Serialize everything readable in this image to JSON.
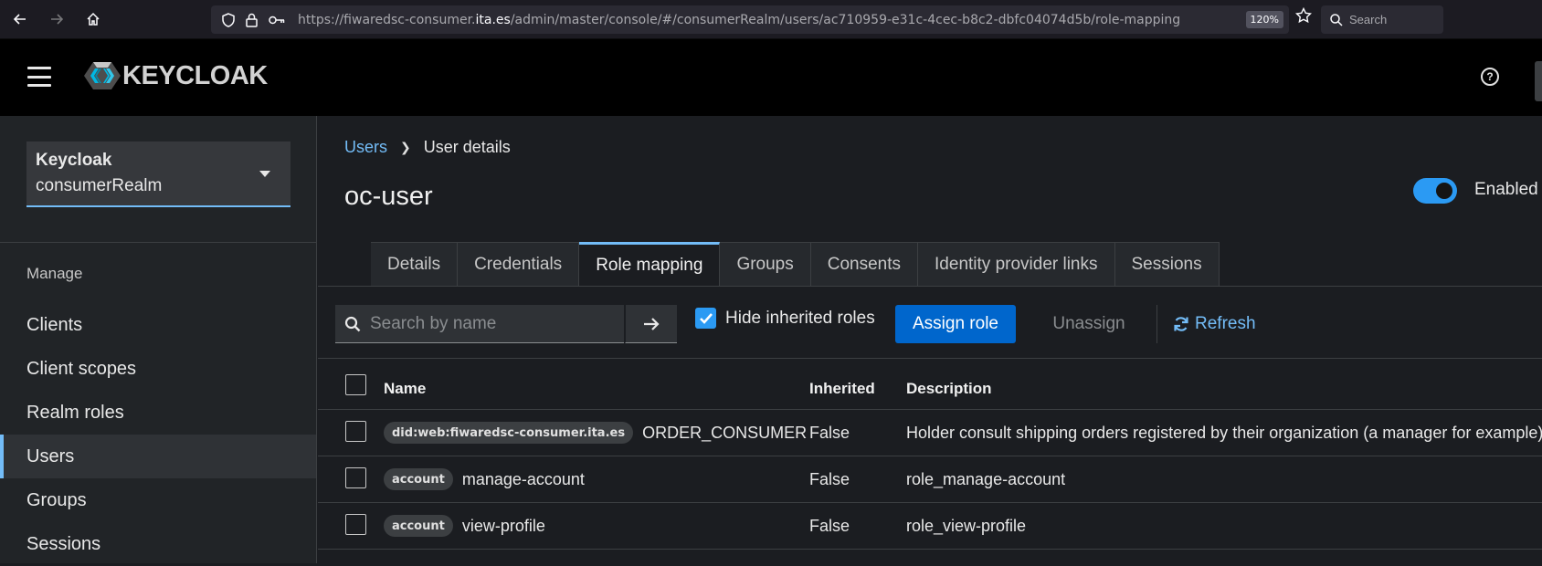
{
  "browser": {
    "url_prefix": "https://fiwaredsc-consumer.",
    "url_host": "ita.es",
    "url_rest": "/admin/master/console/#/consumerRealm/users/ac710959-e31c-4cec-b8c2-dbfc04074d5b/role-mapping",
    "zoom": "120%",
    "search_placeholder": "Search"
  },
  "header": {
    "logo_text": "KEYCLOAK"
  },
  "sidebar": {
    "realm_title": "Keycloak",
    "realm_name": "consumerRealm",
    "section_label": "Manage",
    "items": [
      {
        "label": "Clients"
      },
      {
        "label": "Client scopes"
      },
      {
        "label": "Realm roles"
      },
      {
        "label": "Users"
      },
      {
        "label": "Groups"
      },
      {
        "label": "Sessions"
      }
    ]
  },
  "main": {
    "breadcrumb_link": "Users",
    "breadcrumb_current": "User details",
    "title": "oc-user",
    "enabled_label": "Enabled",
    "tabs": [
      {
        "label": "Details"
      },
      {
        "label": "Credentials"
      },
      {
        "label": "Role mapping"
      },
      {
        "label": "Groups"
      },
      {
        "label": "Consents"
      },
      {
        "label": "Identity provider links"
      },
      {
        "label": "Sessions"
      }
    ],
    "search_placeholder": "Search by name",
    "hide_inherited_label": "Hide inherited roles",
    "assign_label": "Assign role",
    "unassign_label": "Unassign",
    "refresh_label": "Refresh",
    "table": {
      "headers": {
        "name": "Name",
        "inherited": "Inherited",
        "description": "Description"
      },
      "rows": [
        {
          "client": "did:web:fiwaredsc-consumer.ita.es",
          "role": "ORDER_CONSUMER",
          "inherited": "False",
          "description": "Holder consult shipping orders registered by their organization (a manager for example)"
        },
        {
          "client": "account",
          "role": "manage-account",
          "inherited": "False",
          "description": "role_manage-account"
        },
        {
          "client": "account",
          "role": "view-profile",
          "inherited": "False",
          "description": "role_view-profile"
        }
      ]
    }
  }
}
